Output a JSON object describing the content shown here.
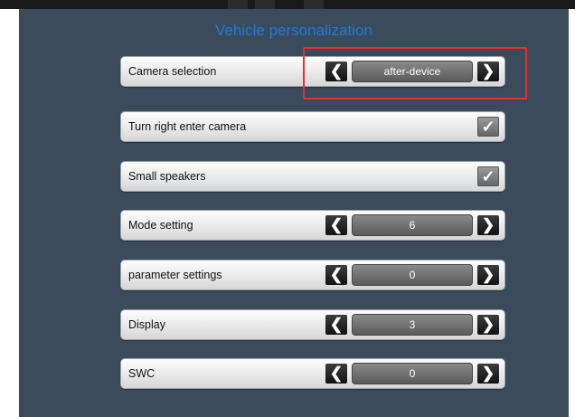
{
  "title": "Vehicle personalization",
  "prev_glyph": "❮",
  "next_glyph": "❯",
  "check_glyph": "✓",
  "rows": [
    {
      "label": "Camera selection",
      "value": "after-device"
    },
    {
      "label": "Turn right enter camera",
      "checked": true
    },
    {
      "label": "Small speakers",
      "checked": true
    },
    {
      "label": "Mode setting",
      "value": "6"
    },
    {
      "label": "parameter settings",
      "value": "0"
    },
    {
      "label": "Display",
      "value": "3"
    },
    {
      "label": "SWC",
      "value": "0"
    }
  ],
  "colors": {
    "title": "#1d7be0",
    "background": "#3b4b5b",
    "highlight_border": "#e53030"
  }
}
